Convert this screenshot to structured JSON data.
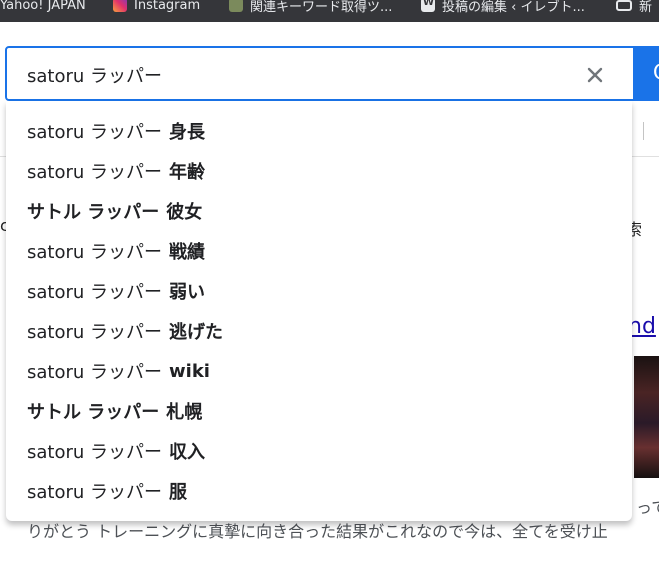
{
  "bookmarks_bar": {
    "items": [
      {
        "label": "Yahoo! JAPAN",
        "icon": "none"
      },
      {
        "label": "Instagram",
        "icon": "instagram-icon"
      },
      {
        "label": "関連キーワード取得ツ...",
        "icon": "image-icon"
      },
      {
        "label": "投稿の編集 ‹ イレブト...",
        "icon": "wordpress-icon"
      },
      {
        "label": "新",
        "icon": "folder-icon"
      }
    ]
  },
  "search": {
    "query": "satoru ラッパー",
    "button_glyph": "Q"
  },
  "suggestions": [
    {
      "base": "satoru ラッパー",
      "completion": "身長",
      "bold_base": false
    },
    {
      "base": "satoru ラッパー",
      "completion": "年齢",
      "bold_base": false
    },
    {
      "base": "サトル ラッパー",
      "completion": "彼女",
      "bold_base": true
    },
    {
      "base": "satoru ラッパー",
      "completion": "戦績",
      "bold_base": false
    },
    {
      "base": "satoru ラッパー",
      "completion": "弱い",
      "bold_base": false
    },
    {
      "base": "satoru ラッパー",
      "completion": "逃げた",
      "bold_base": false
    },
    {
      "base": "satoru ラッパー",
      "completion": "wiki",
      "bold_base": false
    },
    {
      "base": "サトル ラッパー",
      "completion": "札幌",
      "bold_base": true
    },
    {
      "base": "satoru ラッパー",
      "completion": "収入",
      "bold_base": false
    },
    {
      "base": "satoru ラッパー",
      "completion": "服",
      "bold_base": false
    }
  ],
  "background": {
    "left_fragment": "c",
    "right_fragment": "索",
    "link_fragment": "nd",
    "right_fragment_2": "って",
    "snippet": "りがとう トレーニングに真摯に向き合った結果がこれなので今は、全てを受け止"
  },
  "colors": {
    "accent": "#1a73e8",
    "bookmarks_bg": "#35363a",
    "link": "#1a0dab"
  }
}
